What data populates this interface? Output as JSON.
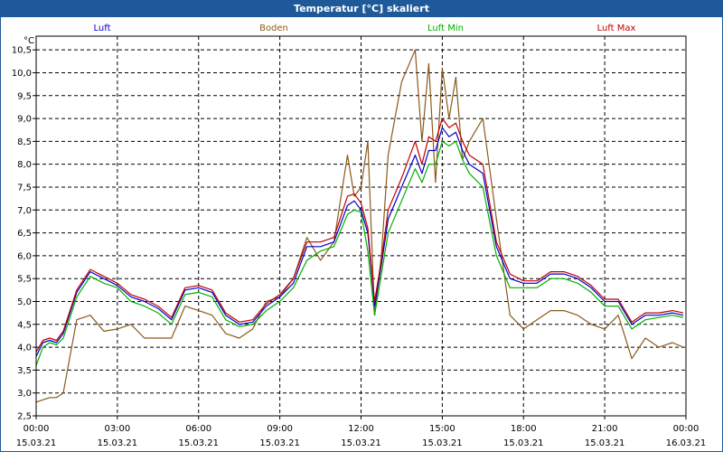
{
  "window": {
    "title": "Temperatur [°C] skaliert"
  },
  "colors": {
    "titlebar": "#1e5a9a",
    "luft": "#0000cc",
    "boden": "#8b5a1a",
    "luft_min": "#00b000",
    "luft_max": "#c00000"
  },
  "chart_data": {
    "type": "line",
    "title": "Temperatur [°C] skaliert",
    "ylabel": "°C",
    "xlabel": "",
    "ylim": [
      2.5,
      10.8
    ],
    "xlim": [
      0,
      24
    ],
    "grid": true,
    "legend": "top",
    "yticks": [
      "2,5",
      "3,0",
      "3,5",
      "4,0",
      "4,5",
      "5,0",
      "5,5",
      "6,0",
      "6,5",
      "7,0",
      "7,5",
      "8,0",
      "8,5",
      "9,0",
      "9,5",
      "10,0",
      "10,5"
    ],
    "xticks": [
      {
        "time": "00:00",
        "date": "15.03.21"
      },
      {
        "time": "03:00",
        "date": "15.03.21"
      },
      {
        "time": "06:00",
        "date": "15.03.21"
      },
      {
        "time": "09:00",
        "date": "15.03.21"
      },
      {
        "time": "12:00",
        "date": "15.03.21"
      },
      {
        "time": "15:00",
        "date": "15.03.21"
      },
      {
        "time": "18:00",
        "date": "15.03.21"
      },
      {
        "time": "21:00",
        "date": "15.03.21"
      },
      {
        "time": "00:00",
        "date": "16.03.21"
      }
    ],
    "x": [
      0,
      0.25,
      0.5,
      0.75,
      1.0,
      1.5,
      2.0,
      2.5,
      3.0,
      3.5,
      4.0,
      4.5,
      5.0,
      5.5,
      6.0,
      6.5,
      7.0,
      7.5,
      8.0,
      8.5,
      9.0,
      9.5,
      10.0,
      10.5,
      11.0,
      11.5,
      11.75,
      12.0,
      12.25,
      12.5,
      12.75,
      13.0,
      13.5,
      14.0,
      14.25,
      14.5,
      14.75,
      15.0,
      15.25,
      15.5,
      15.75,
      16.0,
      16.5,
      17.0,
      17.5,
      18.0,
      18.5,
      19.0,
      19.5,
      20.0,
      20.5,
      21.0,
      21.5,
      22.0,
      22.5,
      23.0,
      23.5,
      23.9
    ],
    "series": [
      {
        "name": "Luft",
        "color": "#0000cc",
        "values": [
          3.8,
          4.1,
          4.15,
          4.1,
          4.3,
          5.2,
          5.65,
          5.5,
          5.35,
          5.1,
          5.0,
          4.85,
          4.6,
          5.25,
          5.3,
          5.2,
          4.7,
          4.5,
          4.55,
          4.9,
          5.1,
          5.4,
          6.2,
          6.2,
          6.3,
          7.1,
          7.2,
          7.0,
          6.5,
          4.9,
          5.8,
          6.8,
          7.5,
          8.2,
          7.8,
          8.3,
          8.3,
          8.8,
          8.6,
          8.7,
          8.3,
          8.0,
          7.8,
          6.2,
          5.5,
          5.4,
          5.4,
          5.6,
          5.6,
          5.5,
          5.3,
          5.0,
          5.0,
          4.5,
          4.7,
          4.7,
          4.75,
          4.7
        ]
      },
      {
        "name": "Boden",
        "color": "#8b5a1a",
        "values": [
          2.8,
          2.85,
          2.9,
          2.9,
          3.0,
          4.6,
          4.7,
          4.35,
          4.4,
          4.5,
          4.2,
          4.2,
          4.2,
          4.9,
          4.8,
          4.7,
          4.3,
          4.2,
          4.4,
          5.0,
          5.1,
          5.5,
          6.4,
          5.9,
          6.3,
          8.2,
          7.3,
          7.5,
          8.5,
          4.7,
          6.0,
          8.2,
          9.8,
          10.5,
          8.5,
          10.2,
          7.6,
          10.1,
          9.0,
          9.9,
          8.1,
          8.5,
          9.0,
          6.8,
          4.7,
          4.4,
          4.6,
          4.8,
          4.8,
          4.7,
          4.5,
          4.4,
          4.7,
          3.75,
          4.2,
          4.0,
          4.1,
          4.0
        ]
      },
      {
        "name": "Luft Min",
        "color": "#00b000",
        "values": [
          3.6,
          4.0,
          4.1,
          4.05,
          4.2,
          5.1,
          5.55,
          5.4,
          5.3,
          5.0,
          4.9,
          4.75,
          4.5,
          5.15,
          5.2,
          5.1,
          4.6,
          4.45,
          4.5,
          4.8,
          5.0,
          5.3,
          5.9,
          6.1,
          6.2,
          6.9,
          7.0,
          6.95,
          6.1,
          4.7,
          5.6,
          6.5,
          7.2,
          7.9,
          7.6,
          8.0,
          8.0,
          8.5,
          8.4,
          8.5,
          8.1,
          7.8,
          7.5,
          6.0,
          5.3,
          5.3,
          5.3,
          5.5,
          5.5,
          5.4,
          5.2,
          4.9,
          4.9,
          4.4,
          4.6,
          4.65,
          4.7,
          4.65
        ]
      },
      {
        "name": "Luft Max",
        "color": "#c00000",
        "values": [
          3.9,
          4.15,
          4.2,
          4.15,
          4.35,
          5.25,
          5.7,
          5.55,
          5.4,
          5.15,
          5.05,
          4.9,
          4.65,
          5.3,
          5.35,
          5.25,
          4.75,
          4.55,
          4.6,
          4.95,
          5.15,
          5.5,
          6.3,
          6.3,
          6.4,
          7.3,
          7.35,
          7.15,
          6.6,
          5.0,
          5.9,
          7.0,
          7.7,
          8.5,
          8.0,
          8.6,
          8.5,
          9.0,
          8.8,
          8.9,
          8.5,
          8.2,
          8.0,
          6.3,
          5.6,
          5.45,
          5.45,
          5.65,
          5.65,
          5.55,
          5.35,
          5.05,
          5.05,
          4.55,
          4.75,
          4.75,
          4.8,
          4.75
        ]
      }
    ]
  }
}
